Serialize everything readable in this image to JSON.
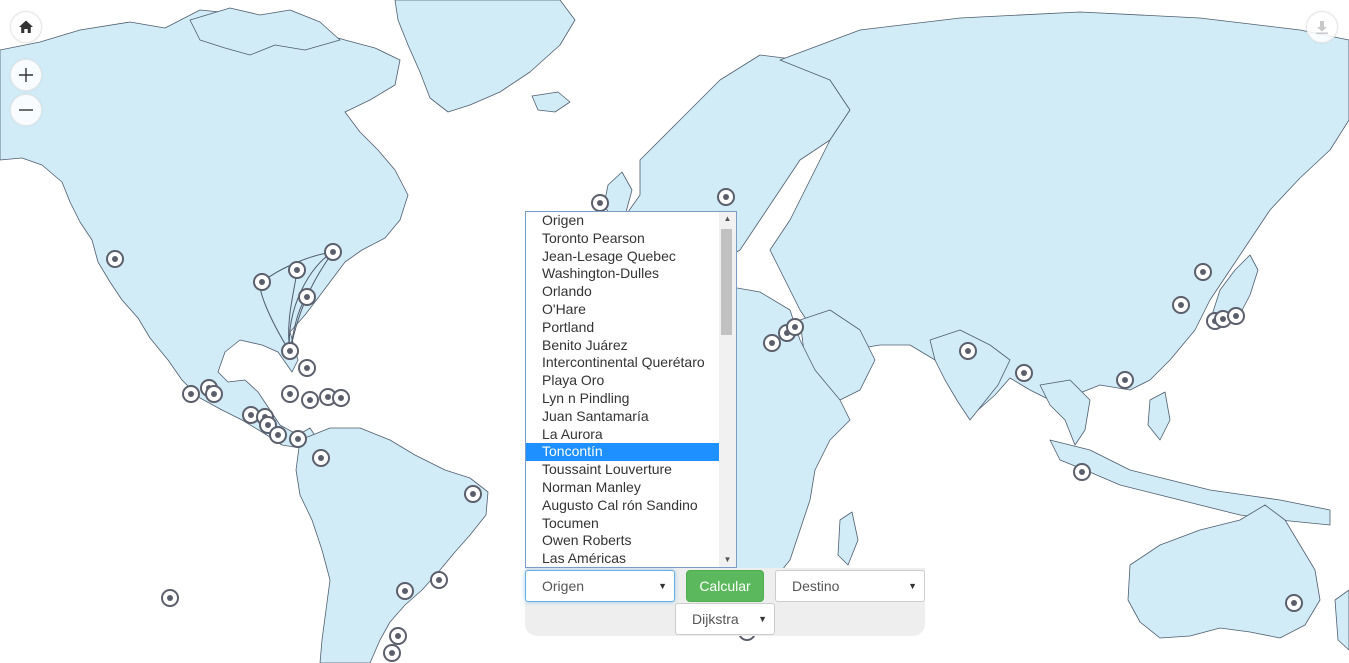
{
  "controls": {
    "home": "home-icon",
    "zoom_in": "plus-icon",
    "zoom_out": "minus-icon",
    "export": "download-icon"
  },
  "airport_list": {
    "items": [
      "Origen",
      "Toronto Pearson",
      "Jean-Lesage Quebec",
      "Washington-Dulles",
      "Orlando",
      "O'Hare",
      "Portland",
      "Benito Juárez",
      "Intercontinental Querétaro",
      "Playa Oro",
      "Lyn n Pindling",
      "Juan Santamaría",
      "La Aurora",
      "Toncontín",
      "Toussaint Louverture",
      "Norman Manley",
      "Augusto Cal rón Sandino",
      "Tocumen",
      "Owen Roberts",
      "Las Américas"
    ],
    "selected_index": 13
  },
  "form": {
    "origin_value": "Origen",
    "calculate_label": "Calcular",
    "destination_value": "Destino",
    "algorithm_value": "Dijkstra"
  },
  "colors": {
    "land": "#d1ecf7",
    "border": "#4f5d6e",
    "marker": "#5b5f6b",
    "selected": "#1e90ff",
    "calculate": "#5cb85c"
  }
}
